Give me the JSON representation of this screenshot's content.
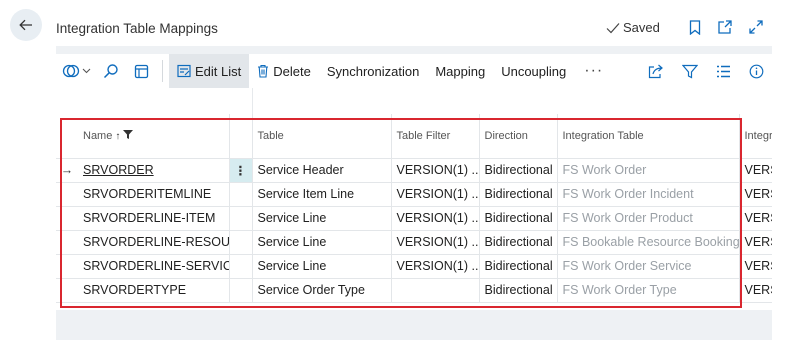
{
  "header": {
    "title": "Integration Table Mappings",
    "saved_label": "Saved"
  },
  "toolbar": {
    "edit_list": "Edit List",
    "delete": "Delete",
    "synchronization": "Synchronization",
    "mapping": "Mapping",
    "uncoupling": "Uncoupling",
    "more": "···"
  },
  "table": {
    "columns": {
      "name": "Name",
      "table": "Table",
      "table_filter": "Table Filter",
      "direction": "Direction",
      "integration_table": "Integration Table",
      "integration_filter": "Integra"
    },
    "row_indicator": "→",
    "row_menu": "⋮",
    "rows": [
      {
        "name": "SRVORDER",
        "table": "Service Header",
        "filter": "VERSION(1) ...",
        "direction": "Bidirectional",
        "integration_table": "FS Work Order",
        "integration_filter": "VERS"
      },
      {
        "name": "SRVORDERITEMLINE",
        "table": "Service Item Line",
        "filter": "VERSION(1) ...",
        "direction": "Bidirectional",
        "integration_table": "FS Work Order Incident",
        "integration_filter": "VERS"
      },
      {
        "name": "SRVORDERLINE-ITEM",
        "table": "Service Line",
        "filter": "VERSION(1) ...",
        "direction": "Bidirectional",
        "integration_table": "FS Work Order Product",
        "integration_filter": "VERS"
      },
      {
        "name": "SRVORDERLINE-RESOURC",
        "table": "Service Line",
        "filter": "VERSION(1) ...",
        "direction": "Bidirectional",
        "integration_table": "FS Bookable Resource Booking",
        "integration_filter": "VERS"
      },
      {
        "name": "SRVORDERLINE-SERVICE",
        "table": "Service Line",
        "filter": "VERSION(1) ...",
        "direction": "Bidirectional",
        "integration_table": "FS Work Order Service",
        "integration_filter": "VERS"
      },
      {
        "name": "SRVORDERTYPE",
        "table": "Service Order Type",
        "filter": "",
        "direction": "Bidirectional",
        "integration_table": "FS Work Order Type",
        "integration_filter": "VERS"
      }
    ]
  },
  "colors": {
    "highlight_frame": "#d9262f",
    "selected_cell": "#d6ecf0",
    "accent": "#0f6cbd"
  }
}
